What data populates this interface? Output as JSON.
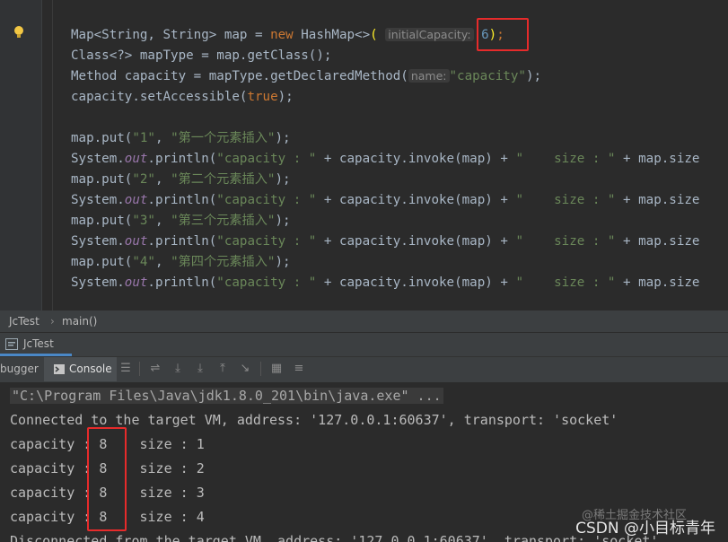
{
  "editor": {
    "lines": [
      {
        "parts": [
          "Map<String, String> map = ",
          "new",
          " HashMap<>",
          "(",
          "initialCapacity:",
          " 6",
          ")",
          ";"
        ]
      },
      {
        "text": "Class<?> mapType = map.getClass();"
      },
      {
        "parts": [
          "Method capacity = mapType.getDeclaredMethod(",
          "name:",
          "\"capacity\"",
          ");"
        ]
      },
      {
        "parts": [
          "capacity.setAccessible(",
          "true",
          ");"
        ]
      },
      {
        "parts": [
          "map.put(",
          "\"1\"",
          ", ",
          "\"第一个元素插入\"",
          ");"
        ]
      },
      {
        "parts": [
          "System.",
          "out",
          ".println(",
          "\"capacity : \"",
          " + capacity.invoke(map) + ",
          "\"    size : \"",
          " + map.size"
        ]
      },
      {
        "parts": [
          "map.put(",
          "\"2\"",
          ", ",
          "\"第二个元素插入\"",
          ");"
        ]
      },
      {
        "parts": [
          "System.",
          "out",
          ".println(",
          "\"capacity : \"",
          " + capacity.invoke(map) + ",
          "\"    size : \"",
          " + map.size"
        ]
      },
      {
        "parts": [
          "map.put(",
          "\"3\"",
          ", ",
          "\"第三个元素插入\"",
          ");"
        ]
      },
      {
        "parts": [
          "System.",
          "out",
          ".println(",
          "\"capacity : \"",
          " + capacity.invoke(map) + ",
          "\"    size : \"",
          " + map.size"
        ]
      },
      {
        "parts": [
          "map.put(",
          "\"4\"",
          ", ",
          "\"第四个元素插入\"",
          ");"
        ]
      },
      {
        "parts": [
          "System.",
          "out",
          ".println(",
          "\"capacity : \"",
          " + capacity.invoke(map) + ",
          "\"    size : \"",
          " + map.size"
        ]
      }
    ]
  },
  "breadcrumb": {
    "class_name": "JcTest",
    "separator": "›",
    "method": "main()"
  },
  "run_tab": {
    "label": "JcTest"
  },
  "toolbar": {
    "debugger_label": "bugger",
    "console_label": "Console"
  },
  "console": {
    "command": "\"C:\\Program Files\\Java\\jdk1.8.0_201\\bin\\java.exe\" ...",
    "connected": "Connected to the target VM, address: '127.0.0.1:60637', transport: 'socket'",
    "outputs": [
      "capacity : 8    size : 1",
      "capacity : 8    size : 2",
      "capacity : 8    size : 3",
      "capacity : 8    size : 4"
    ],
    "disconnected": "Disconnected from the target VM, address: '127.0.0.1:60637', transport: 'socket'"
  },
  "watermark": {
    "text": "CSDN @小目标青年",
    "faint": "@稀土掘金技术社区"
  },
  "colors": {
    "keyword": "#cc7832",
    "string": "#6a8759",
    "field": "#9876aa",
    "number": "#6897bb",
    "highlight_box": "#e62b2b",
    "accent": "#4a88c7"
  }
}
